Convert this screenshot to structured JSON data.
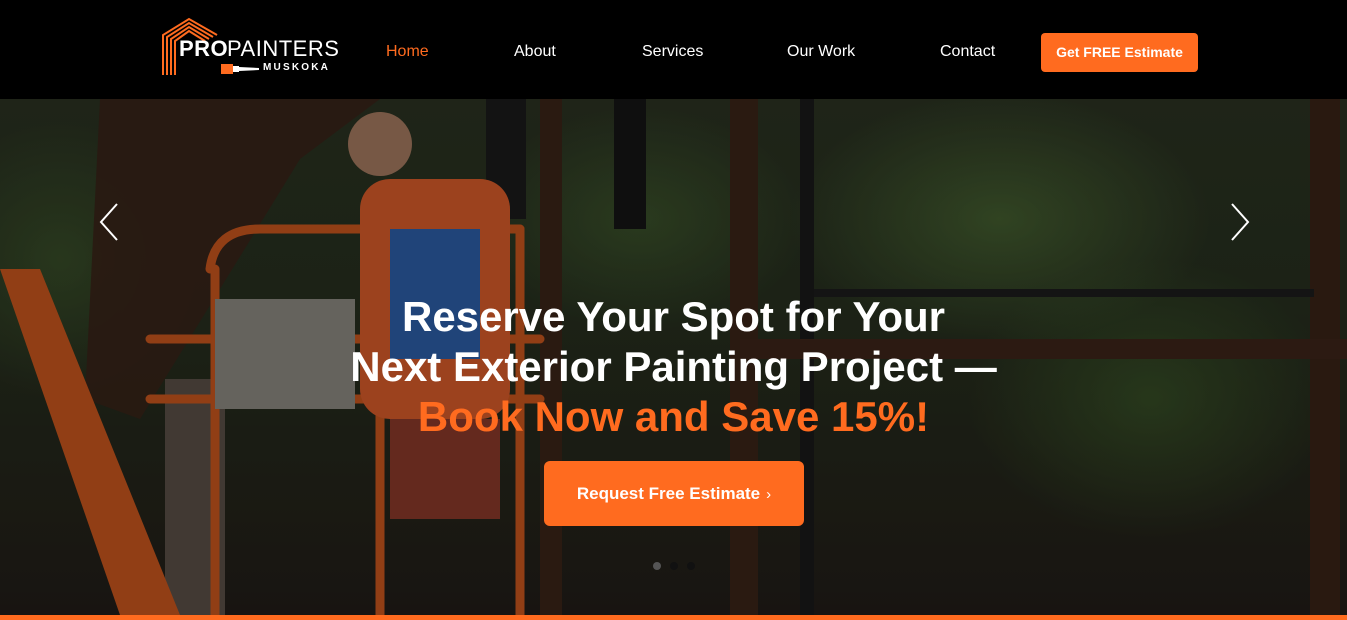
{
  "brand": {
    "logo_pro": "PRO",
    "logo_painters": "PAINTERS",
    "logo_sub": "MUSKOKA",
    "accent_color": "#ff6b1f"
  },
  "nav": {
    "items": [
      {
        "label": "Home",
        "active": true
      },
      {
        "label": "About",
        "active": false
      },
      {
        "label": "Services",
        "active": false
      },
      {
        "label": "Our Work",
        "active": false
      },
      {
        "label": "Contact",
        "active": false
      }
    ],
    "cta_label": "Get FREE Estimate"
  },
  "hero": {
    "headline_line1": "Reserve Your Spot for Your",
    "headline_line2": "Next Exterior Painting Project —",
    "headline_accent": "Book Now and Save 15%!",
    "cta_label": "Request Free Estimate",
    "cta_chevron": "›",
    "prev_icon": "chevron-left-icon",
    "next_icon": "chevron-right-icon",
    "slide_count": 3,
    "active_slide": 1
  }
}
